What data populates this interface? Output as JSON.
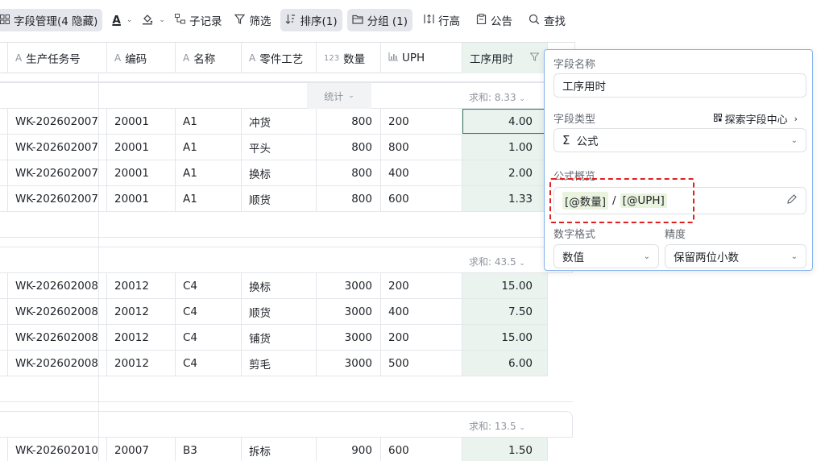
{
  "toolbar": {
    "fields_label": "字段管理(4 隐藏)",
    "text_color_glyph": "A",
    "child_record_label": "子记录",
    "filter_label": "筛选",
    "sort_label": "排序(1)",
    "group_label": "分组 (1)",
    "row_height_label": "行高",
    "announce_label": "公告",
    "search_label": "查找"
  },
  "columns": [
    {
      "type_icon": "A",
      "label": "生产任务号"
    },
    {
      "type_icon": "A",
      "label": "编码"
    },
    {
      "type_icon": "A",
      "label": "名称"
    },
    {
      "type_icon": "A",
      "label": "零件工艺"
    },
    {
      "type_icon": "123",
      "label": "数量"
    },
    {
      "type_icon": "bar-chart-icon",
      "label": "UPH"
    },
    {
      "type_icon": "",
      "label": "工序用时"
    }
  ],
  "group_sums": {
    "stat_label": "统计",
    "g1": "求和: 8.33",
    "g2": "求和: 43.5",
    "g3": "求和: 13.5"
  },
  "rows": [
    {
      "task": "WK-202602007",
      "code": "20001",
      "name": "A1",
      "process": "冲货",
      "qty": "800",
      "uph": "200",
      "time": "4.00"
    },
    {
      "task": "WK-202602007",
      "code": "20001",
      "name": "A1",
      "process": "平头",
      "qty": "800",
      "uph": "800",
      "time": "1.00"
    },
    {
      "task": "WK-202602007",
      "code": "20001",
      "name": "A1",
      "process": "换标",
      "qty": "800",
      "uph": "400",
      "time": "2.00"
    },
    {
      "task": "WK-202602007",
      "code": "20001",
      "name": "A1",
      "process": "顺货",
      "qty": "800",
      "uph": "600",
      "time": "1.33"
    },
    {
      "task": "WK-202602008",
      "code": "20012",
      "name": "C4",
      "process": "换标",
      "qty": "3000",
      "uph": "200",
      "time": "15.00"
    },
    {
      "task": "WK-202602008",
      "code": "20012",
      "name": "C4",
      "process": "顺货",
      "qty": "3000",
      "uph": "400",
      "time": "7.50"
    },
    {
      "task": "WK-202602008",
      "code": "20012",
      "name": "C4",
      "process": "铺货",
      "qty": "3000",
      "uph": "200",
      "time": "15.00"
    },
    {
      "task": "WK-202602008",
      "code": "20012",
      "name": "C4",
      "process": "剪毛",
      "qty": "3000",
      "uph": "500",
      "time": "6.00"
    },
    {
      "task": "WK-202602010",
      "code": "20007",
      "name": "B3",
      "process": "拆标",
      "qty": "900",
      "uph": "600",
      "time": "1.50"
    }
  ],
  "panel": {
    "field_name_label": "字段名称",
    "field_name_value": "工序用时",
    "field_type_label": "字段类型",
    "explore_label": "探索字段中心",
    "field_type_value": "公式",
    "formula_label": "公式概览",
    "formula_token1": "[@数量]",
    "formula_op": "/",
    "formula_token2": "[@UPH]",
    "number_format_label": "数字格式",
    "number_format_value": "数值",
    "precision_label": "精度",
    "precision_value": "保留两位小数"
  },
  "colors": {
    "accent_green": "#eaf3ee",
    "panel_border": "#86b4ef",
    "highlight_red": "#e02020"
  }
}
